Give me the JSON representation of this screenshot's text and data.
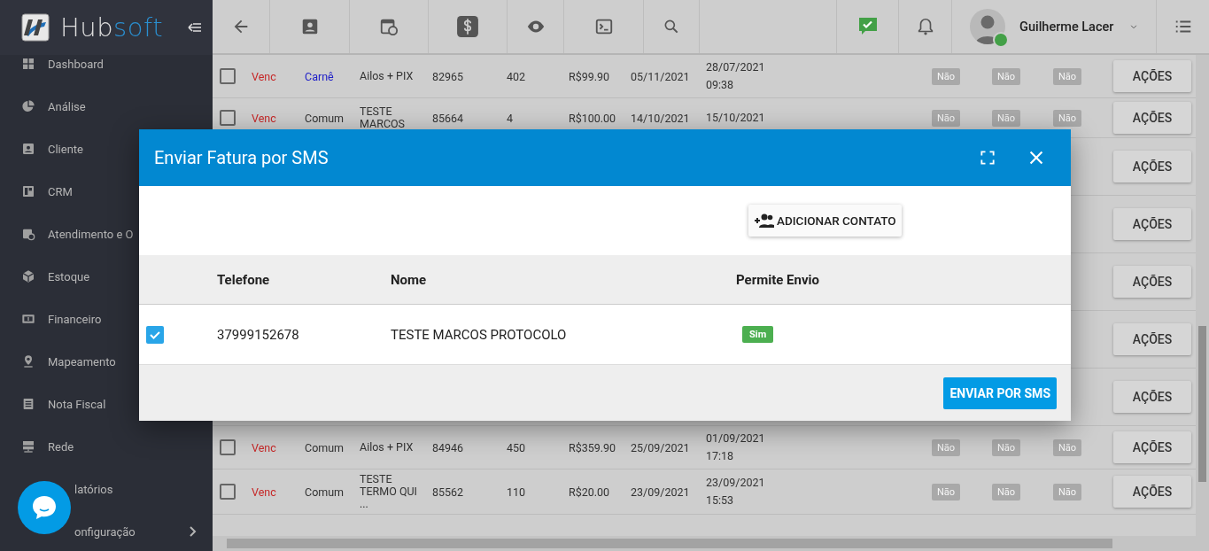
{
  "brand": {
    "name_a": "Hub",
    "name_b": "soft"
  },
  "sidebar": {
    "items": [
      {
        "label": "Dashboard",
        "submenu": false
      },
      {
        "label": "Análise",
        "submenu": false
      },
      {
        "label": "Cliente",
        "submenu": false
      },
      {
        "label": "CRM",
        "submenu": false
      },
      {
        "label": "Atendimento e O",
        "submenu": false
      },
      {
        "label": "Estoque",
        "submenu": false
      },
      {
        "label": "Financeiro",
        "submenu": false
      },
      {
        "label": "Mapeamento",
        "submenu": false
      },
      {
        "label": "Nota Fiscal",
        "submenu": false
      },
      {
        "label": "Rede",
        "submenu": false
      },
      {
        "label": "latórios",
        "submenu": false
      },
      {
        "label": "onfiguração",
        "submenu": true
      }
    ]
  },
  "user": {
    "name": "Guilherme Lacer",
    "online": true
  },
  "table": {
    "rows": [
      {
        "checked": false,
        "status": "Venc",
        "type": "Carnê",
        "color": "#2020c8",
        "description": "Ailos + PIX",
        "id": "82965",
        "number": "402",
        "value": "R$99.90",
        "due": "05/11/2021",
        "date": "28/07/2021",
        "time": "09:38",
        "flags": [
          "Não",
          "Não",
          "Não"
        ],
        "action": "AÇÕES"
      },
      {
        "checked": false,
        "status": "Venc",
        "type": "Comum",
        "color": "#333333",
        "description": "TESTE MARCOS",
        "id": "85664",
        "number": "4",
        "value": "R$100.00",
        "due": "14/10/2021",
        "date": "15/10/2021",
        "flags": [
          "Não",
          "Não",
          "Não"
        ],
        "action": "AÇÕES"
      },
      {
        "action": "AÇÕES"
      },
      {
        "action": "AÇÕES"
      },
      {
        "action": "AÇÕES"
      },
      {
        "action": "AÇÕES"
      },
      {
        "action": "AÇÕES"
      },
      {
        "checked": false,
        "status": "Venc",
        "type": "Comum",
        "color": "#333333",
        "description": "Ailos + PIX",
        "id": "84946",
        "number": "450",
        "value": "R$359.90",
        "due": "25/09/2021",
        "date": "01/09/2021",
        "time": "17:18",
        "flags": [
          "Não",
          "Não",
          "Não"
        ],
        "action": "AÇÕES"
      },
      {
        "checked": false,
        "status": "Venc",
        "type": "Comum",
        "color": "#333333",
        "description": "TESTE TERMO QUI ...",
        "id": "85562",
        "number": "110",
        "value": "R$20.00",
        "due": "23/09/2021",
        "date": "23/09/2021",
        "time": "15:53",
        "flags": [
          "Não",
          "Não",
          "Não"
        ],
        "action": "AÇÕES"
      }
    ]
  },
  "modal": {
    "title": "Enviar Fatura por SMS",
    "add_button": "ADICIONAR CONTATO",
    "columns": [
      "Telefone",
      "Nome",
      "Permite Envio"
    ],
    "rows": [
      {
        "checked": true,
        "phone": "37999152678",
        "name": "TESTE MARCOS PROTOCOLO",
        "allowed": "Sim"
      }
    ],
    "send_button": "ENVIAR POR SMS"
  }
}
